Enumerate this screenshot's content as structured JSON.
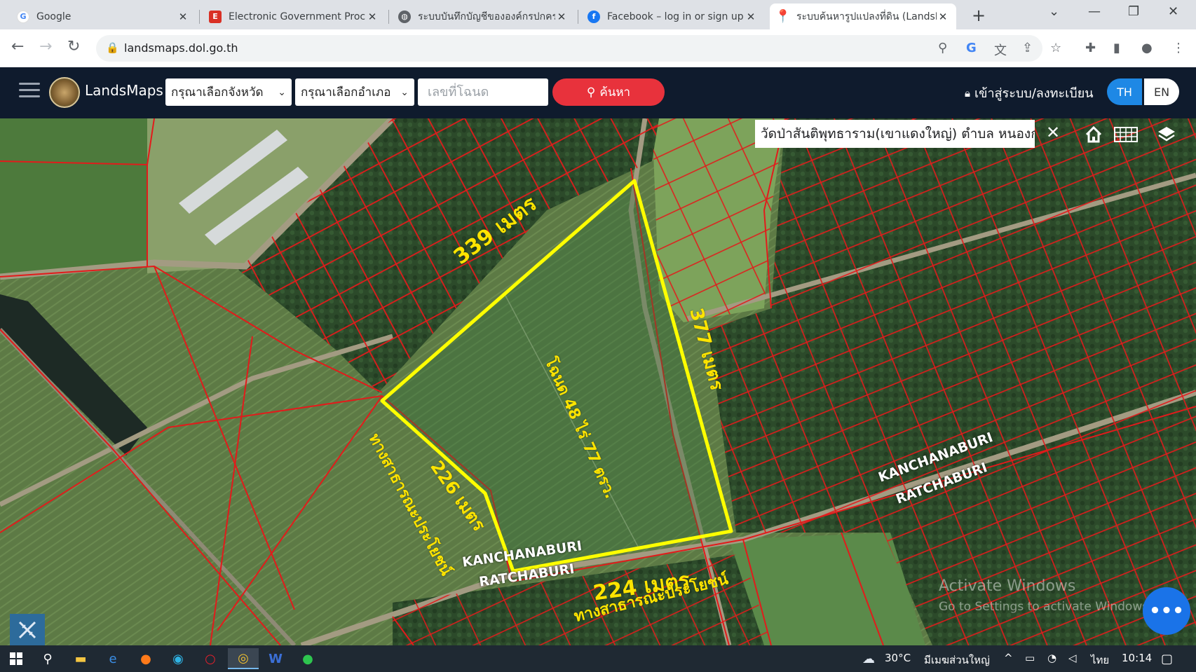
{
  "browser": {
    "tabs": [
      {
        "title": "Google",
        "icon": "google-icon",
        "active": false
      },
      {
        "title": "Electronic Government Procu",
        "icon": "egp-icon",
        "active": false
      },
      {
        "title": "ระบบบันทึกบัญชีขององค์กรปกครอ",
        "icon": "globe-icon",
        "active": false
      },
      {
        "title": "Facebook – log in or sign up",
        "icon": "facebook-icon",
        "active": false
      },
      {
        "title": "ระบบค้นหารูปแปลงที่ดิน (LandsM",
        "icon": "map-pin-icon",
        "active": true
      }
    ],
    "url": "landsmaps.dol.go.th"
  },
  "app": {
    "brand": "LandsMaps",
    "province_select": "กรุณาเลือกจังหวัด",
    "district_select": "กรุณาเลือกอำเภอ",
    "deed_placeholder": "เลขที่โฉนด",
    "search_label": "ค้นหา",
    "login_label": "เข้าสู่ระบบ/ลงทะเบียน",
    "lang_th": "TH",
    "lang_en": "EN",
    "accent_color": "#e8323c",
    "lang_active_color": "#1e88e5"
  },
  "map": {
    "place_search_value": "วัดป่าสันติพุทธาราม(เขาแดงใหญ่) ตำบล หนองกร",
    "parcel_color": "#ffff00",
    "boundary_color": "#e21b1b",
    "parcel_labels": {
      "north_edge": "339 เมตร",
      "east_edge": "377 เมตร",
      "southwest_edge": "226 เมตร",
      "south_edge": "224 เมตร",
      "deed_area": "โฉนด 48 ไร่ 77 ตรว.",
      "public_way_1": "ทางสาธารณะประโยชน์",
      "public_way_2": "ทางสาธารณะประโยชน์"
    },
    "province_labels": {
      "a_top": "KANCHANABURI",
      "a_bottom": "RATCHABURI",
      "b_top": "KANCHANABURI",
      "b_bottom": "RATCHABURI"
    },
    "watermark_title": "Activate Windows",
    "watermark_sub": "Go to Settings to activate Windows.",
    "chat_label": "•••"
  },
  "taskbar": {
    "temperature": "30°C",
    "weather": "มีเมฆส่วนใหญ่",
    "ime": "ไทย",
    "time": "10:14"
  }
}
